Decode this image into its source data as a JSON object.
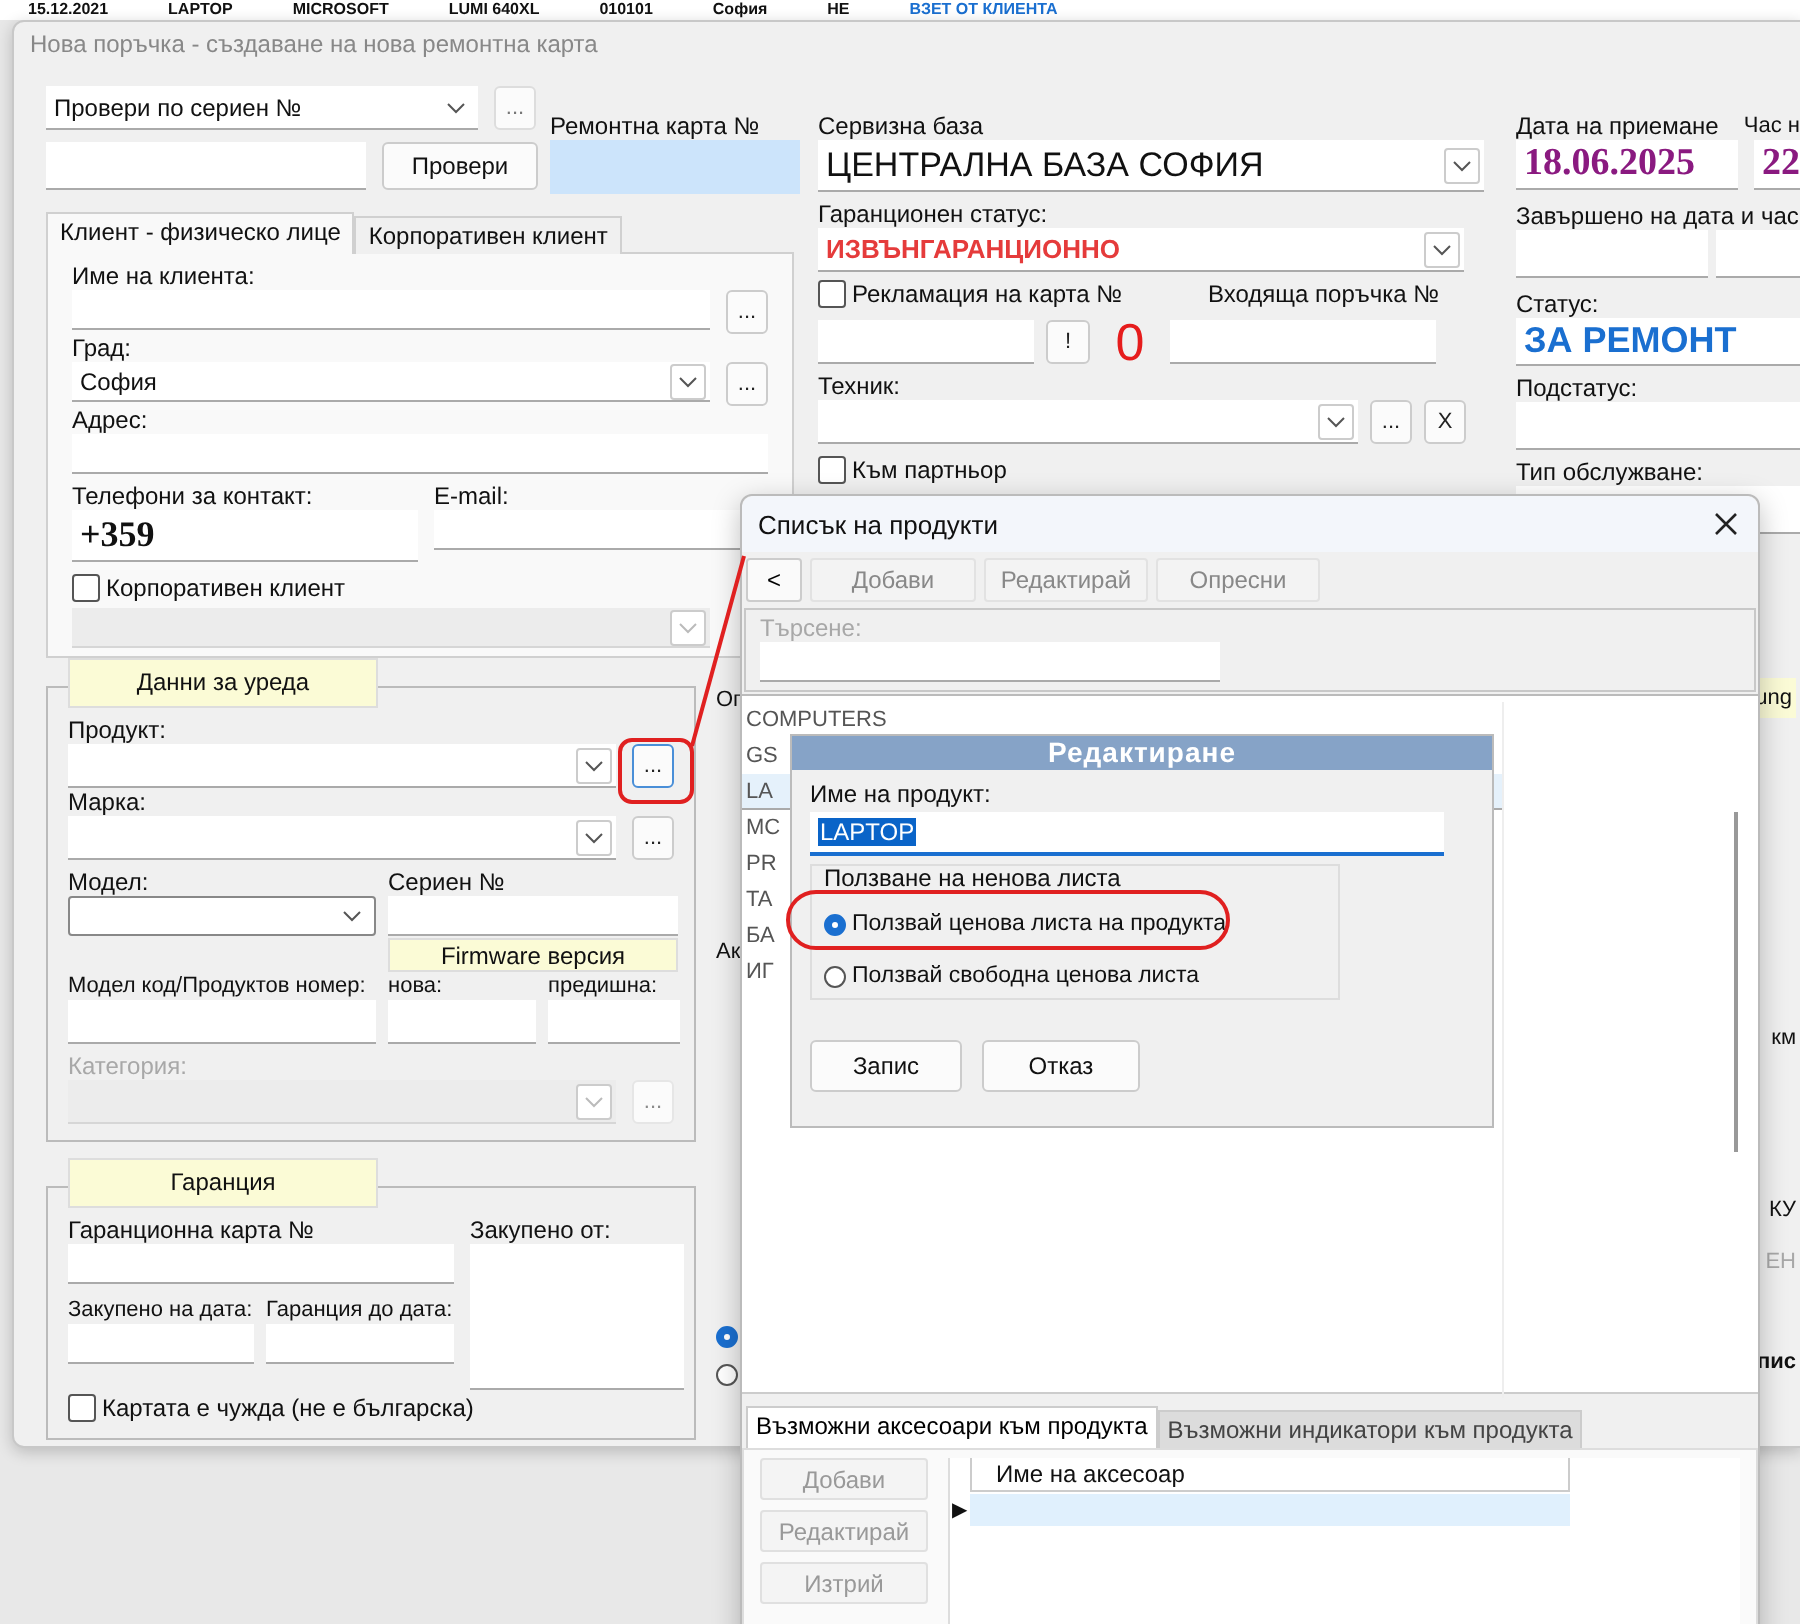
{
  "background_row": {
    "cells": [
      "15.12.2021",
      "LAPTOP",
      "MICROSOFT",
      "LUMI 640XL",
      "010101",
      "София",
      "НЕ",
      "ВЗЕТ ОТ КЛИЕНТА"
    ]
  },
  "window": {
    "title": "Нова поръчка - създаване на нова ремонтна карта"
  },
  "serial_check": {
    "mode": "Провери по сериен №",
    "more_button": "...",
    "check_button": "Провери"
  },
  "repair_card": {
    "label": "Ремонтна карта №"
  },
  "client_tabs": [
    {
      "label": "Клиент - физическо лице",
      "selected": true
    },
    {
      "label": "Корпоративен клиент",
      "selected": false
    }
  ],
  "client": {
    "name_label": "Име на клиента:",
    "name_button": "...",
    "city_label": "Град:",
    "city": "София",
    "city_button": "...",
    "address_label": "Адрес:",
    "phone_label": "Телефони за контакт:",
    "phone": "+359",
    "email_label": "E-mail:",
    "corporate": {
      "label": "Корпоративен клиент",
      "checked": false
    }
  },
  "device": {
    "header": "Данни за уреда",
    "product_label": "Продукт:",
    "product_button": "...",
    "brand_label": "Марка:",
    "brand_button": "...",
    "model_label": "Модел:",
    "serial_label": "Сериен №",
    "firmware": "Firmware версия",
    "model_code_label": "Модел код/Продуктов номер:",
    "new_label": "нова:",
    "previous_label": "предишна:",
    "category": {
      "label": "Категория:",
      "button": "...",
      "disabled": true
    }
  },
  "warranty": {
    "header": "Гаранция",
    "card_label": "Гаранционна карта №",
    "bought_from_label": "Закупено от:",
    "bought_date_label": "Закупено на дата:",
    "until_label": "Гаранция до дата:",
    "foreign": {
      "label": "Картата е чужда (не е българска)",
      "checked": false
    }
  },
  "service": {
    "base_label": "Сервизна база",
    "base": "ЦЕНТРАЛНА БАЗА СОФИЯ",
    "warranty_status_label": "Гаранционен статус:",
    "warranty_status": "ИЗВЪНГАРАНЦИОННО",
    "complaint": {
      "label": "Рекламация на карта №",
      "checked": false
    },
    "incoming_label": "Входяща поръчка №",
    "bang_button": "!",
    "count": "0",
    "technician_label": "Техник:",
    "technician_button": "...",
    "clear_button": "X",
    "partner": {
      "label": "Към партньор",
      "checked": false
    },
    "hidden_labels": [
      "Оп",
      "Ак"
    ],
    "hidden_radios": [
      {
        "selected": true
      },
      {
        "selected": false
      }
    ]
  },
  "dates": {
    "received_label": "Дата на приемане",
    "time_label": "Час н",
    "received": "18.06.2025",
    "time": "22",
    "completed_label": "Завършено на дата и час:",
    "status_label": "Статус:",
    "status": "ЗА РЕМОНТ",
    "substatus_label": "Подстатус:",
    "service_type_label": "Тип обслужване:",
    "fragments": [
      "ung",
      "км",
      "КУ",
      "ЕН",
      "пис"
    ]
  },
  "product_list": {
    "title": "Списък на продукти",
    "back_button": "<",
    "toolbar": [
      "Добави",
      "Редактирай",
      "Опресни"
    ],
    "search_label": "Търсене:",
    "items": [
      {
        "label": "COMPUTERS",
        "selected": false
      },
      {
        "label": "GS",
        "selected": false
      },
      {
        "label": "LA",
        "selected": true
      },
      {
        "label": "MC",
        "selected": false
      },
      {
        "label": "PR",
        "selected": false
      },
      {
        "label": "TA",
        "selected": false
      },
      {
        "label": "БА",
        "selected": false
      },
      {
        "label": "ИГ",
        "selected": false
      }
    ],
    "bottom_tabs": [
      {
        "label": "Възможни аксесоари към продукта",
        "selected": true
      },
      {
        "label": "Възможни индикатори към продукта",
        "selected": false
      }
    ],
    "side_buttons": [
      "Добави",
      "Редактирай",
      "Изтрий"
    ],
    "grid_column": "Име на аксесоар",
    "row_indicator": "▶"
  },
  "edit_dialog": {
    "title": "Редактиране",
    "name_label": "Име на продукт:",
    "name": "LAPTOP",
    "price_group": "Ползване на ненова листа",
    "options": [
      {
        "label": "Ползвай ценова листа на продукта",
        "selected": true
      },
      {
        "label": "Ползвай свободна ценова листа",
        "selected": false
      }
    ],
    "buttons": [
      "Запис",
      "Отказ"
    ]
  }
}
